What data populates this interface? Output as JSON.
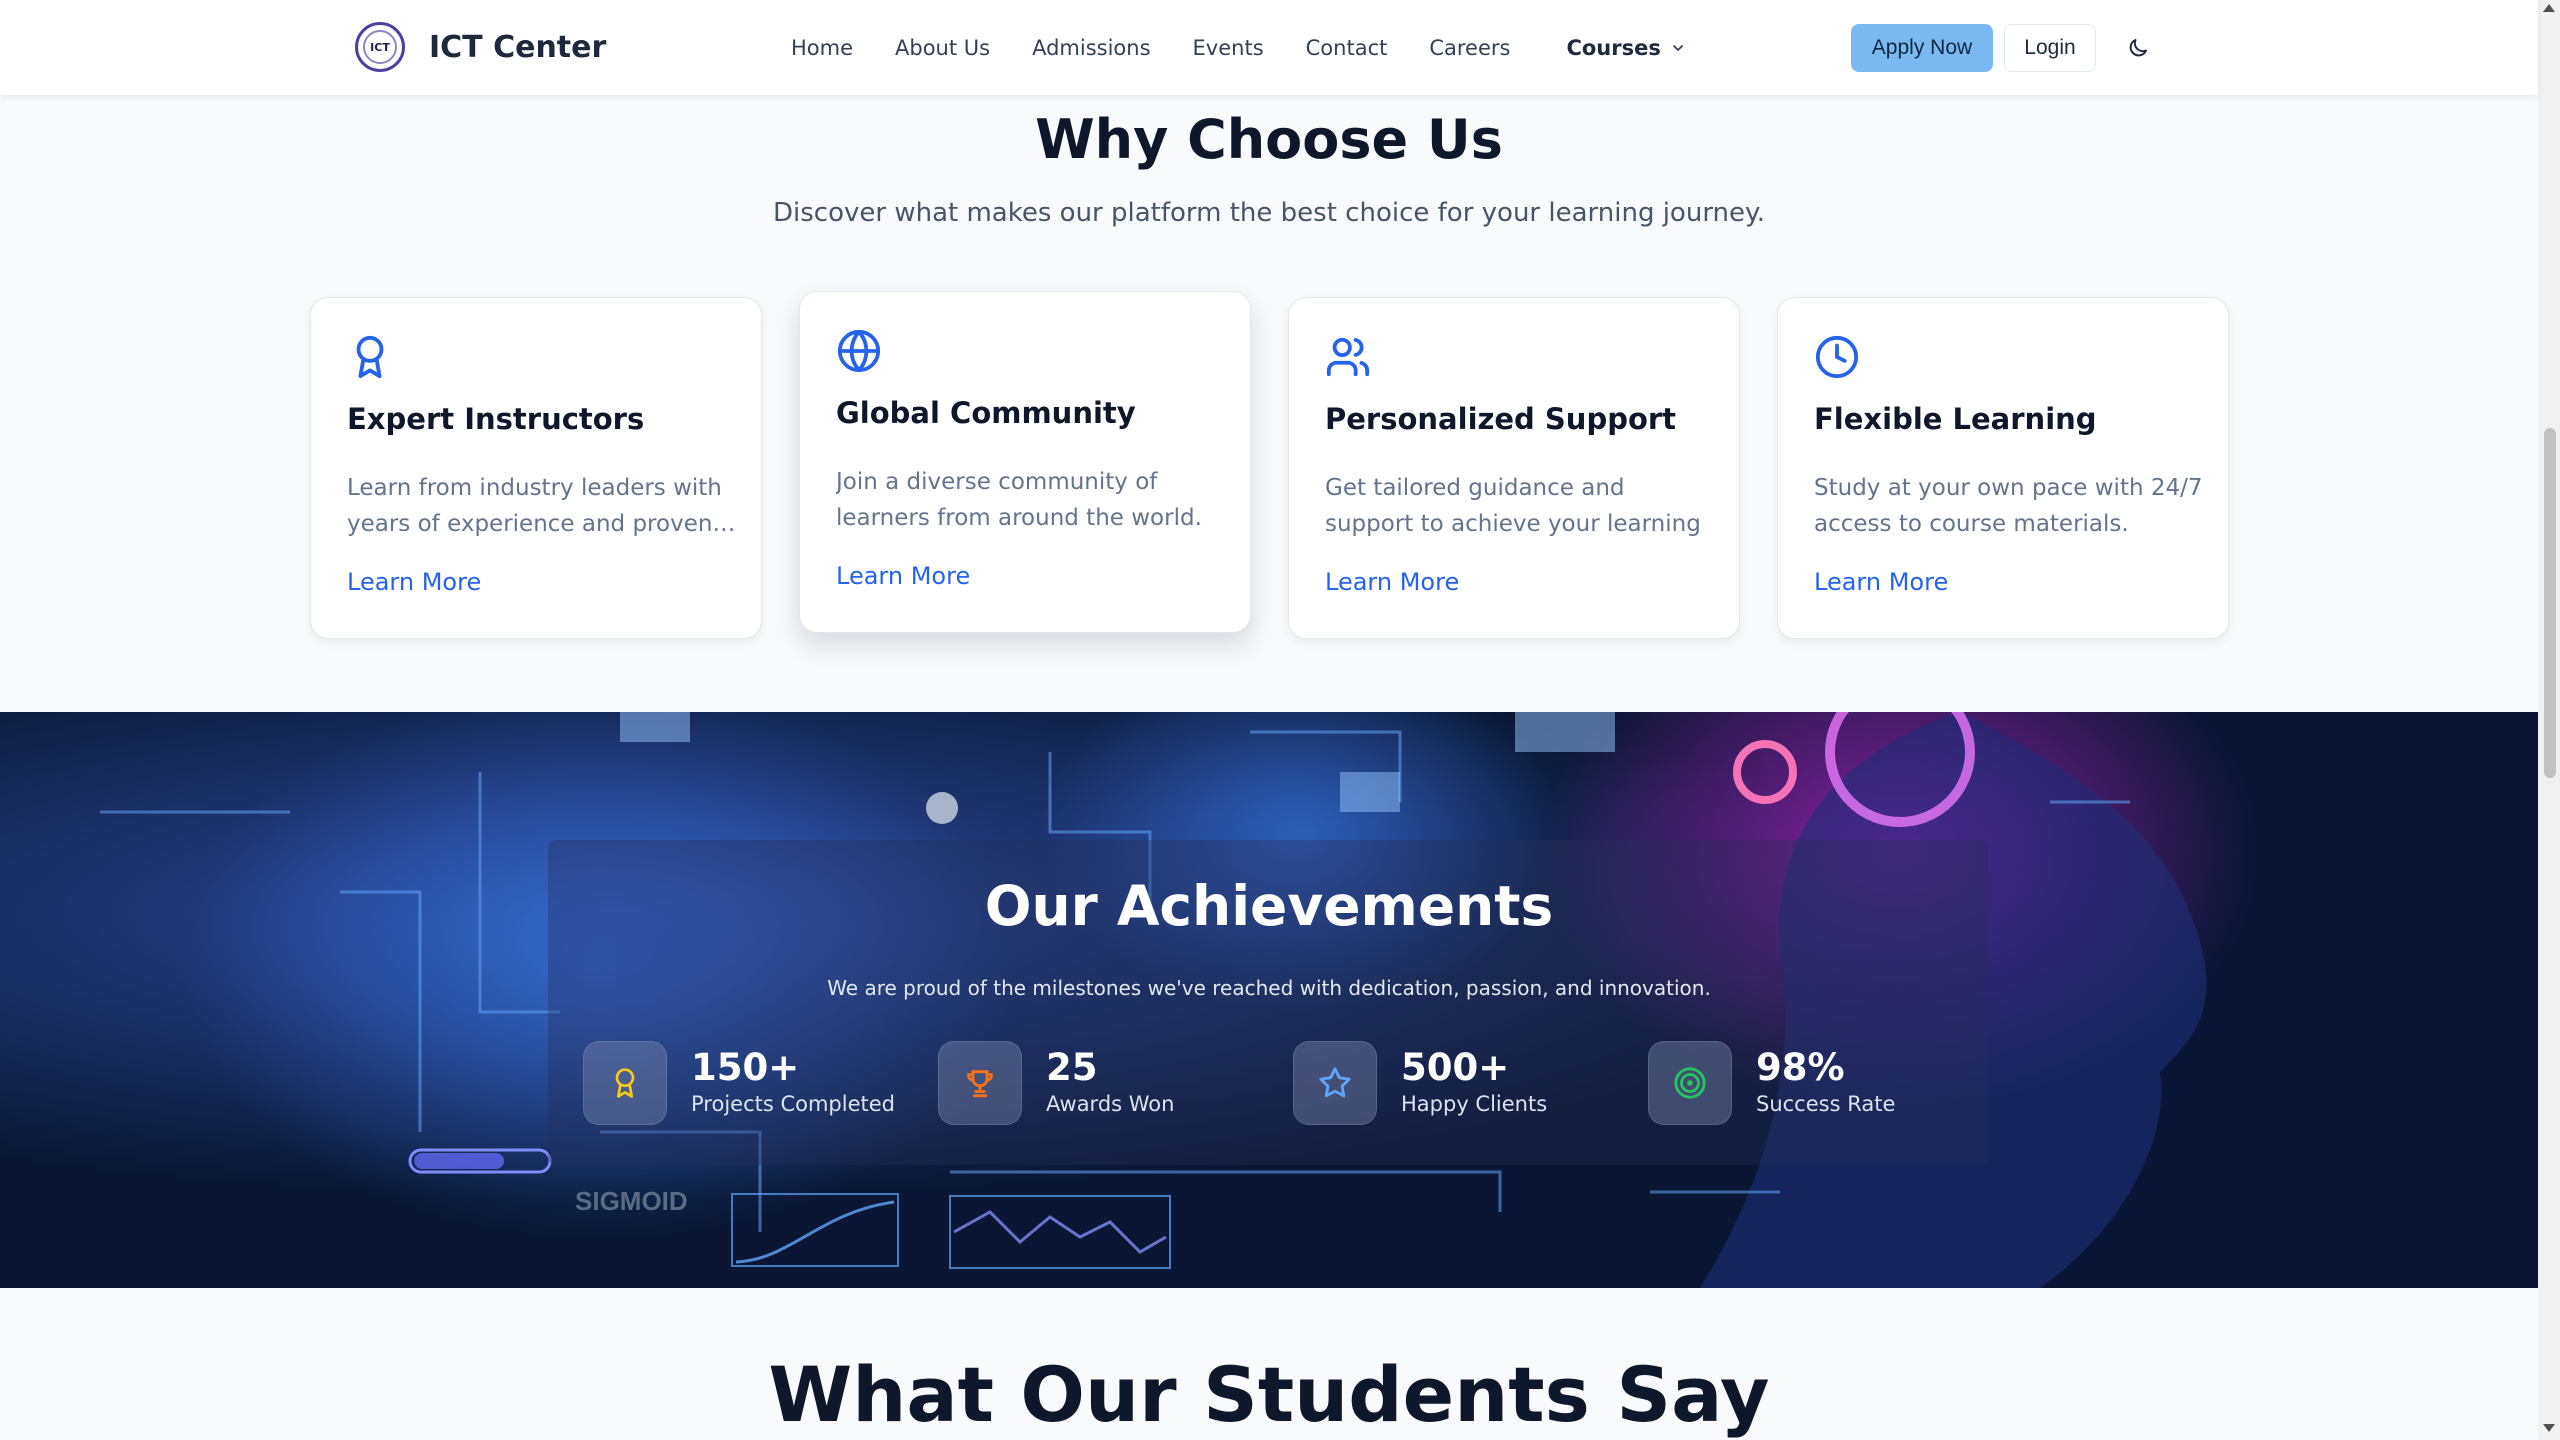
{
  "nav": {
    "brand": "ICT Center",
    "logo_text": "ICT",
    "links": [
      "Home",
      "About Us",
      "Admissions",
      "Events",
      "Contact",
      "Careers"
    ],
    "courses": "Courses",
    "apply": "Apply Now",
    "login": "Login",
    "theme_icon": "moon-icon",
    "accent": "#7ab8f0"
  },
  "why": {
    "title": "Why Choose Us",
    "subtitle": "Discover what makes our platform the best choice for your learning journey.",
    "cards": [
      {
        "icon": "award-icon",
        "title": "Expert Instructors",
        "desc": "Learn from industry leaders with years of experience and proven…",
        "link": "Learn More"
      },
      {
        "icon": "globe-icon",
        "title": "Global Community",
        "desc": "Join a diverse community of learners from around the world.",
        "link": "Learn More"
      },
      {
        "icon": "users-icon",
        "title": "Personalized Support",
        "desc": "Get tailored guidance and support to achieve your learning goals.",
        "link": "Learn More"
      },
      {
        "icon": "clock-icon",
        "title": "Flexible Learning",
        "desc": "Study at your own pace with 24/7 access to course materials.",
        "link": "Learn More"
      }
    ],
    "icon_color": "#2563eb"
  },
  "achievements": {
    "title": "Our Achievements",
    "subtitle": "We are proud of the milestones we've reached with dedication, passion, and innovation.",
    "stats": [
      {
        "icon": "award-icon",
        "value": "150+",
        "label": "Projects Completed",
        "color": "#facc15"
      },
      {
        "icon": "trophy-icon",
        "value": "25",
        "label": "Awards Won",
        "color": "#f97316"
      },
      {
        "icon": "star-icon",
        "value": "500+",
        "label": "Happy Clients",
        "color": "#60a5fa"
      },
      {
        "icon": "target-icon",
        "value": "98%",
        "label": "Success Rate",
        "color": "#22c55e"
      }
    ],
    "background_text": "SIGMOID"
  },
  "testimonials": {
    "title": "What Our Students Say"
  }
}
